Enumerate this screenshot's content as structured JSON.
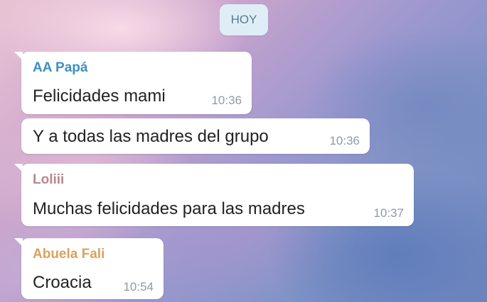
{
  "date_divider": "HOY",
  "messages": [
    {
      "sender": "AA Papá",
      "sender_color": "#3e8fc0",
      "text": "Felicidades mami",
      "time": "10:36"
    },
    {
      "sender": "",
      "text": "Y a todas las madres del grupo",
      "time": "10:36"
    },
    {
      "sender": "Loliii",
      "sender_color": "#b78791",
      "text": "Muchas felicidades para las madres",
      "time": "10:37"
    },
    {
      "sender": "Abuela Fali",
      "sender_color": "#d8a35c",
      "text": "Croacia",
      "time": "10:54"
    }
  ]
}
